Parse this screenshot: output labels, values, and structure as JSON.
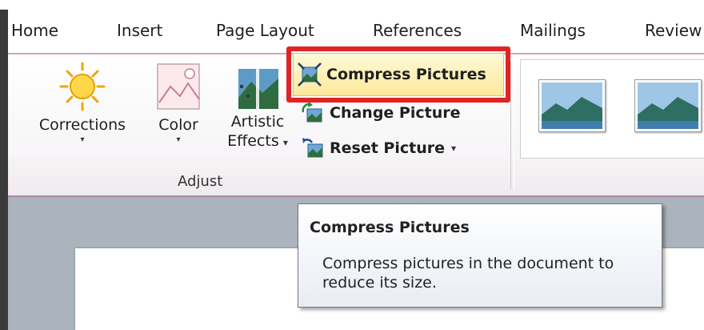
{
  "tabs": [
    "Home",
    "Insert",
    "Page Layout",
    "References",
    "Mailings",
    "Review"
  ],
  "adjust_group": {
    "label": "Adjust",
    "corrections": {
      "label": "Corrections",
      "caret": "▾"
    },
    "color": {
      "label": "Color",
      "caret": "▾"
    },
    "artistic_effects": {
      "label_line1": "Artistic",
      "label_line2": "Effects",
      "caret": "▾"
    },
    "compress_pictures": {
      "label": "Compress Pictures"
    },
    "change_picture": {
      "label": "Change Picture"
    },
    "reset_picture": {
      "label": "Reset Picture",
      "caret": "▾"
    }
  },
  "tooltip": {
    "title": "Compress Pictures",
    "description": "Compress pictures in the document to reduce its size."
  },
  "colors": {
    "highlight": "#e02424",
    "ribbon_accent": "#a98aa3",
    "document_background": "#abb3bd"
  },
  "icons": {
    "corrections": "sun-icon",
    "color": "picture-color-icon",
    "artistic_effects": "artistic-effects-icon",
    "compress_pictures": "compress-pictures-icon",
    "change_picture": "change-picture-icon",
    "reset_picture": "reset-picture-icon"
  }
}
